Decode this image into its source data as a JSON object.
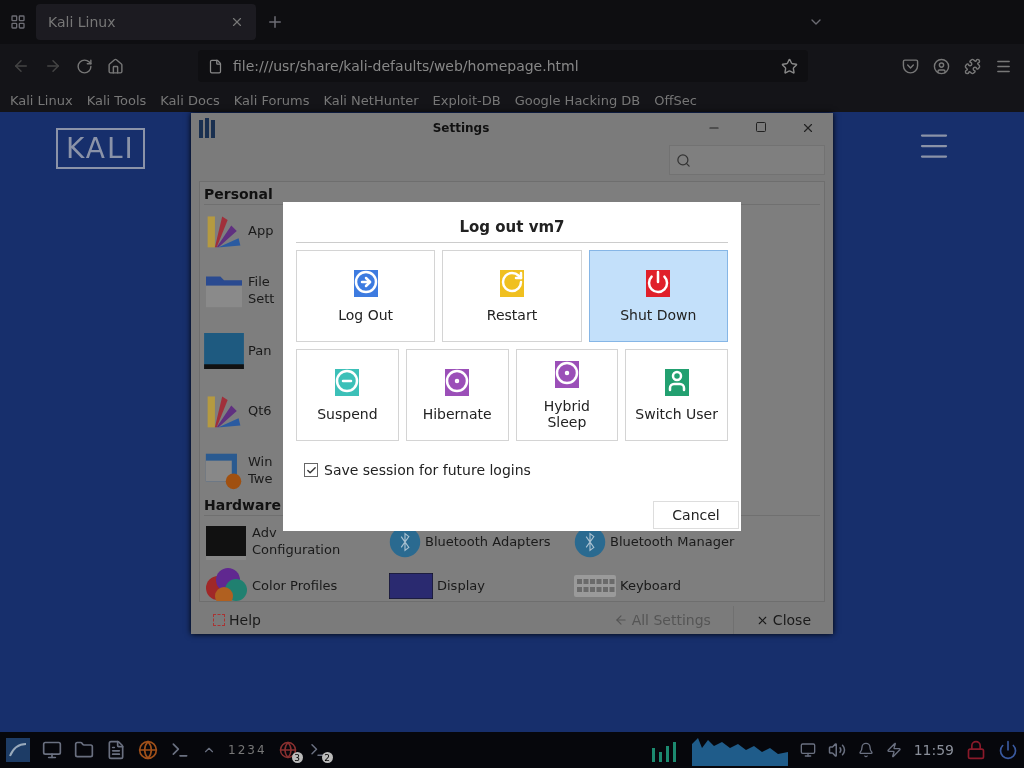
{
  "browser": {
    "tab": {
      "title": "Kali Linux",
      "selected": true
    },
    "url": "file:///usr/share/kali-defaults/web/homepage.html",
    "bookmarks": [
      "Kali Linux",
      "Kali Tools",
      "Kali Docs",
      "Kali Forums",
      "Kali NetHunter",
      "Exploit-DB",
      "Google Hacking DB",
      "OffSec"
    ]
  },
  "page": {
    "logo": "KALI"
  },
  "settings": {
    "title": "Settings",
    "sections": [
      {
        "title": "Personal",
        "items": [
          {
            "label": "App",
            "kind": "fan"
          },
          {
            "label": "File\nSett",
            "kind": "folder"
          },
          {
            "label": "Pan",
            "kind": "panel"
          },
          {
            "label": "Qt6",
            "kind": "fan"
          },
          {
            "label": "Win\nTwe",
            "kind": "window"
          }
        ]
      },
      {
        "title": "Hardware",
        "items": [
          {
            "label": "Adv\nConfiguration",
            "kind": "network"
          },
          {
            "label": "Bluetooth Adapters",
            "kind": "bluetooth"
          },
          {
            "label": "Bluetooth Manager",
            "kind": "bluetooth"
          },
          {
            "label": "Color Profiles",
            "kind": "color"
          },
          {
            "label": "Display",
            "kind": "display"
          },
          {
            "label": "Keyboard",
            "kind": "keyboard"
          }
        ]
      }
    ],
    "footer": {
      "help": "Help",
      "all_settings": {
        "label": "All Settings",
        "disabled": true
      },
      "close": "Close"
    }
  },
  "dialog": {
    "title": "Log out vm7",
    "actions": [
      {
        "label": "Log Out",
        "kind": "logout",
        "color": "#3d7be0",
        "selected": false
      },
      {
        "label": "Restart",
        "kind": "restart",
        "color": "#f0c020",
        "selected": false
      },
      {
        "label": "Shut Down",
        "kind": "power",
        "color": "#e0202a",
        "selected": true
      },
      {
        "label": "Suspend",
        "kind": "suspend",
        "color": "#3cc0b8",
        "selected": false
      },
      {
        "label": "Hibernate",
        "kind": "sleep",
        "color": "#9b4fb8",
        "selected": false
      },
      {
        "label": "Hybrid Sleep",
        "kind": "sleep",
        "color": "#9b4fb8",
        "selected": false
      },
      {
        "label": "Switch User",
        "kind": "user",
        "color": "#22a070",
        "selected": false
      }
    ],
    "save_session": {
      "label": "Save session for future logins",
      "checked": true
    },
    "cancel": "Cancel"
  },
  "taskbar": {
    "workspaces": "1234",
    "badges": [
      "3",
      "2"
    ],
    "clock": "11:59"
  }
}
